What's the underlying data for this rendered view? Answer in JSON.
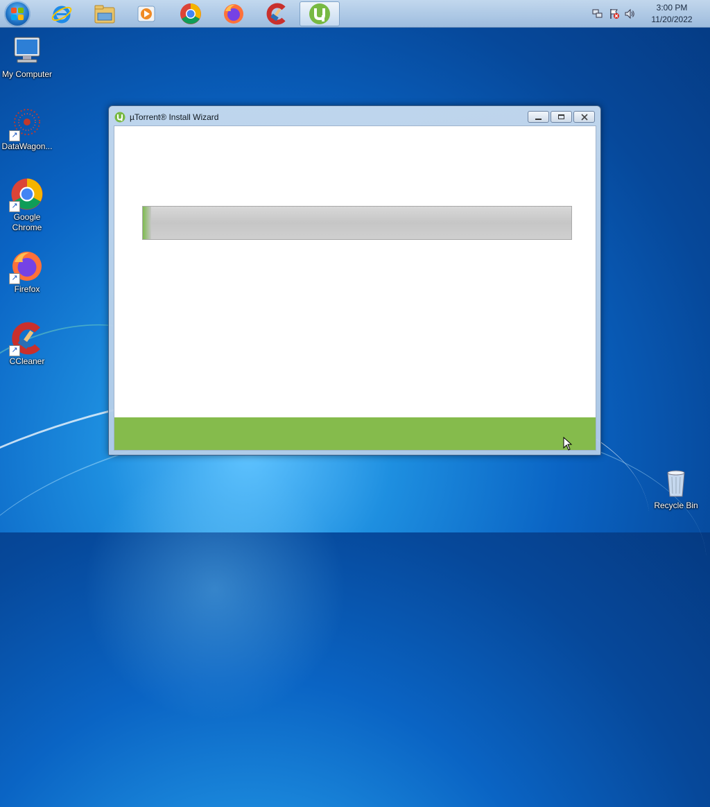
{
  "taskbar": {
    "pinned": [
      {
        "name": "ie-icon"
      },
      {
        "name": "explorer-icon"
      },
      {
        "name": "media-player-icon"
      },
      {
        "name": "chrome-icon"
      },
      {
        "name": "firefox-icon"
      },
      {
        "name": "ccleaner-icon"
      },
      {
        "name": "utorrent-icon"
      }
    ],
    "clock": {
      "time": "3:00 PM",
      "date": "11/20/2022"
    }
  },
  "desktop": {
    "icons": [
      {
        "label": "My Computer"
      },
      {
        "label": "DataWagon..."
      },
      {
        "label": "Google Chrome"
      },
      {
        "label": "Firefox"
      },
      {
        "label": "CCleaner"
      },
      {
        "label": "Recycle Bin"
      }
    ]
  },
  "window": {
    "title": "µTorrent® Install Wizard",
    "progress": 0.02
  },
  "colors": {
    "accent_green": "#85bb4c",
    "progress_track": "#c8c8c8",
    "desktop_blue": "#0a64c4"
  }
}
